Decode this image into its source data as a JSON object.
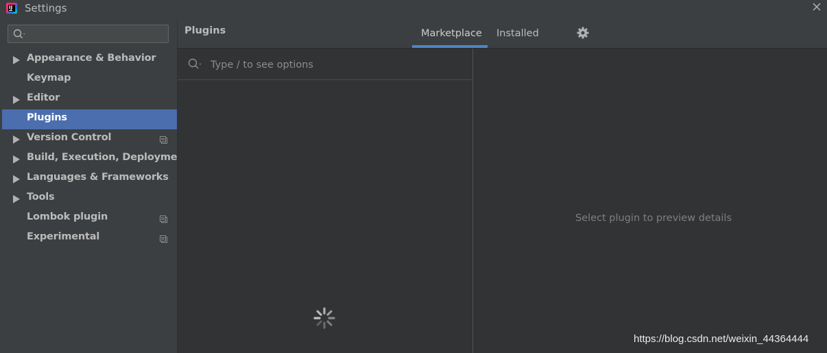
{
  "window": {
    "title": "Settings",
    "app_icon_letters": "IJ",
    "close_icon": "close-icon"
  },
  "sidebar": {
    "search_placeholder": "",
    "items": [
      {
        "label": "Appearance & Behavior",
        "expandable": true,
        "project_icon": false
      },
      {
        "label": "Keymap",
        "expandable": false,
        "project_icon": false
      },
      {
        "label": "Editor",
        "expandable": true,
        "project_icon": false
      },
      {
        "label": "Plugins",
        "expandable": false,
        "project_icon": false,
        "selected": true
      },
      {
        "label": "Version Control",
        "expandable": true,
        "project_icon": true
      },
      {
        "label": "Build, Execution, Deployment",
        "expandable": true,
        "project_icon": false
      },
      {
        "label": "Languages & Frameworks",
        "expandable": true,
        "project_icon": false
      },
      {
        "label": "Tools",
        "expandable": true,
        "project_icon": false
      },
      {
        "label": "Lombok plugin",
        "expandable": false,
        "project_icon": true
      },
      {
        "label": "Experimental",
        "expandable": false,
        "project_icon": true
      }
    ]
  },
  "header": {
    "title": "Plugins",
    "tabs": [
      {
        "label": "Marketplace",
        "active": true
      },
      {
        "label": "Installed",
        "active": false
      }
    ],
    "settings_icon": "gear-icon"
  },
  "plugin_list": {
    "search_placeholder": "Type / to see options",
    "loading": true
  },
  "details": {
    "empty_text": "Select plugin to preview details"
  },
  "watermark": "https://blog.csdn.net/weixin_44364444",
  "colors": {
    "background": "#3c3f41",
    "panel": "#313335",
    "selection": "#4b6eaf",
    "tab_underline": "#4a88c7",
    "text": "#bbbbbb"
  }
}
